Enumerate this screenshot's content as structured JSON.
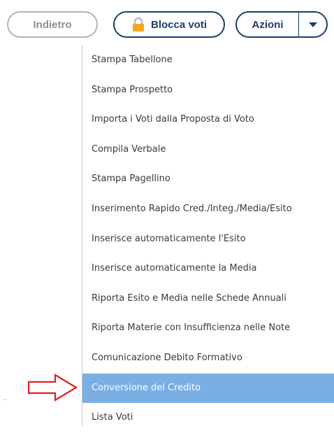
{
  "toolbar": {
    "back_label": "Indietro",
    "lock_label": "Blocca voti",
    "actions_label": "Azioni"
  },
  "icons": {
    "lock": "lock-icon",
    "caret": "caret-down-icon",
    "arrow": "red-arrow-right-icon"
  },
  "colors": {
    "navy": "#1e3d6f",
    "lock": "#f5a623",
    "highlight": "#7baee3",
    "arrow": "#e02020"
  },
  "menu": {
    "items": [
      {
        "label": "Stampa Tabellone"
      },
      {
        "label": "Stampa Prospetto"
      },
      {
        "label": "Importa i Voti dalla Proposta di Voto"
      },
      {
        "label": "Compila Verbale"
      },
      {
        "label": "Stampa Pagellino"
      },
      {
        "label": "Inserimento Rapido Cred./Integ./Media/Esito"
      },
      {
        "label": "Inserisce automaticamente l'Esito"
      },
      {
        "label": "Inserisce automaticamente la Media"
      },
      {
        "label": "Riporta Esito e Media nelle Schede Annuali"
      },
      {
        "label": "Riporta Materie con Insufficienza nelle Note"
      },
      {
        "label": "Comunicazione Debito Formativo"
      },
      {
        "label": "Conversione del Credito"
      },
      {
        "label": "Lista Voti"
      }
    ]
  }
}
